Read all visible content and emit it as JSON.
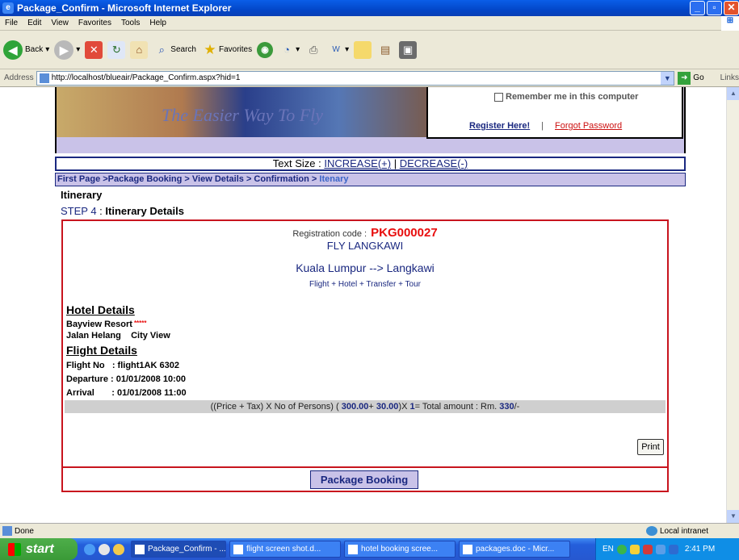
{
  "window": {
    "title": "Package_Confirm - Microsoft Internet Explorer"
  },
  "menu": [
    "File",
    "Edit",
    "View",
    "Favorites",
    "Tools",
    "Help"
  ],
  "toolbar": {
    "back": "Back",
    "search": "Search",
    "favorites": "Favorites"
  },
  "address": {
    "label": "Address",
    "url": "http://localhost/blueair/Package_Confirm.aspx?hid=1",
    "go": "Go",
    "links": "Links"
  },
  "banner": {
    "tagline": "The Easier Way To Fly"
  },
  "login": {
    "remember": "Remember me in this computer",
    "register": "Register Here!",
    "separator": "|",
    "forgot": "Forgot Password"
  },
  "textsize": {
    "label": "Text Size  : ",
    "increase": "INCREASE(+)",
    "sep": " | ",
    "decrease": "DECREASE(-)"
  },
  "breadcrumb": {
    "path": "First Page  >Package Booking > View Details  >  Confirmation > ",
    "current": "Itenary"
  },
  "page": {
    "heading": "Itinerary",
    "step": "STEP 4",
    "step_sep": " : ",
    "step_label": "Itinerary Details"
  },
  "itinerary": {
    "reg_label": "Registration code : ",
    "reg_code": "PKG000027",
    "package": "FLY LANGKAWI",
    "route": "Kuala Lumpur --> Langkawi",
    "services": "Flight + Hotel + Transfer + Tour",
    "hotel_heading": "Hotel Details",
    "hotel_name": "Bayview Resort",
    "hotel_stars": "*****",
    "hotel_address": "Jalan Helang    City View",
    "flight_heading": "Flight Details",
    "flight_no": "Flight No   : flight1AK 6302",
    "departure": "Departure : 01/01/2008 10:00",
    "arrival": "Arrival       : 01/01/2008 11:00",
    "price_prefix": "((Price + Tax) X No of Persons) ( ",
    "price": "300.00",
    "plus": "+ ",
    "tax": "30.00",
    "x": ")X ",
    "persons": "1",
    "eq": "= Total amount : Rm. ",
    "total": "330",
    "suffix": "/-",
    "print": "Print"
  },
  "package_booking": "Package Booking",
  "status": {
    "text": "Done",
    "zone": "Local intranet"
  },
  "taskbar": {
    "start": "start",
    "tasks": [
      "Package_Confirm - ...",
      "flight screen shot.d...",
      "hotel booking scree...",
      "packages.doc - Micr..."
    ],
    "lang": "EN",
    "clock": "2:41 PM"
  },
  "colors": {
    "accent_red": "#c8141e",
    "link_blue": "#1a2880",
    "lavender": "#c9c2e8"
  }
}
